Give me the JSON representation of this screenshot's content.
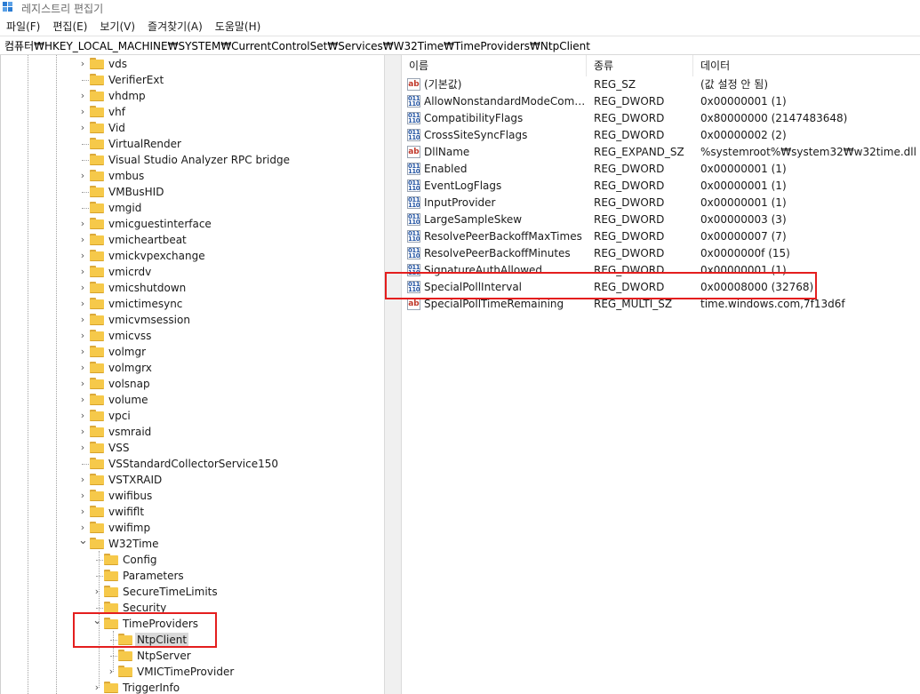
{
  "window": {
    "title": "레지스트리 편집기",
    "icon": "registry-editor-icon"
  },
  "menu": [
    "파일(F)",
    "편집(E)",
    "보기(V)",
    "즐겨찾기(A)",
    "도움말(H)"
  ],
  "address": "컴퓨터₩HKEY_LOCAL_MACHINE₩SYSTEM₩CurrentControlSet₩Services₩W32Time₩TimeProviders₩NtpClient",
  "tree": [
    {
      "label": "vds",
      "level": 0,
      "expander": "collapsed"
    },
    {
      "label": "VerifierExt",
      "level": 0,
      "expander": "none"
    },
    {
      "label": "vhdmp",
      "level": 0,
      "expander": "collapsed"
    },
    {
      "label": "vhf",
      "level": 0,
      "expander": "collapsed"
    },
    {
      "label": "Vid",
      "level": 0,
      "expander": "collapsed"
    },
    {
      "label": "VirtualRender",
      "level": 0,
      "expander": "none"
    },
    {
      "label": "Visual Studio Analyzer RPC bridge",
      "level": 0,
      "expander": "none"
    },
    {
      "label": "vmbus",
      "level": 0,
      "expander": "collapsed"
    },
    {
      "label": "VMBusHID",
      "level": 0,
      "expander": "none"
    },
    {
      "label": "vmgid",
      "level": 0,
      "expander": "none"
    },
    {
      "label": "vmicguestinterface",
      "level": 0,
      "expander": "collapsed"
    },
    {
      "label": "vmicheartbeat",
      "level": 0,
      "expander": "collapsed"
    },
    {
      "label": "vmickvpexchange",
      "level": 0,
      "expander": "collapsed"
    },
    {
      "label": "vmicrdv",
      "level": 0,
      "expander": "collapsed"
    },
    {
      "label": "vmicshutdown",
      "level": 0,
      "expander": "collapsed"
    },
    {
      "label": "vmictimesync",
      "level": 0,
      "expander": "collapsed"
    },
    {
      "label": "vmicvmsession",
      "level": 0,
      "expander": "collapsed"
    },
    {
      "label": "vmicvss",
      "level": 0,
      "expander": "collapsed"
    },
    {
      "label": "volmgr",
      "level": 0,
      "expander": "collapsed"
    },
    {
      "label": "volmgrx",
      "level": 0,
      "expander": "collapsed"
    },
    {
      "label": "volsnap",
      "level": 0,
      "expander": "collapsed"
    },
    {
      "label": "volume",
      "level": 0,
      "expander": "collapsed"
    },
    {
      "label": "vpci",
      "level": 0,
      "expander": "collapsed"
    },
    {
      "label": "vsmraid",
      "level": 0,
      "expander": "collapsed"
    },
    {
      "label": "VSS",
      "level": 0,
      "expander": "collapsed"
    },
    {
      "label": "VSStandardCollectorService150",
      "level": 0,
      "expander": "none"
    },
    {
      "label": "VSTXRAID",
      "level": 0,
      "expander": "collapsed"
    },
    {
      "label": "vwifibus",
      "level": 0,
      "expander": "collapsed"
    },
    {
      "label": "vwififlt",
      "level": 0,
      "expander": "collapsed"
    },
    {
      "label": "vwifimp",
      "level": 0,
      "expander": "collapsed"
    },
    {
      "label": "W32Time",
      "level": 0,
      "expander": "expanded"
    },
    {
      "label": "Config",
      "level": 1,
      "expander": "none"
    },
    {
      "label": "Parameters",
      "level": 1,
      "expander": "none"
    },
    {
      "label": "SecureTimeLimits",
      "level": 1,
      "expander": "collapsed"
    },
    {
      "label": "Security",
      "level": 1,
      "expander": "none"
    },
    {
      "label": "TimeProviders",
      "level": 1,
      "expander": "expanded"
    },
    {
      "label": "NtpClient",
      "level": 2,
      "expander": "none",
      "selected": true
    },
    {
      "label": "NtpServer",
      "level": 2,
      "expander": "none"
    },
    {
      "label": "VMICTimeProvider",
      "level": 2,
      "expander": "collapsed"
    },
    {
      "label": "TriggerInfo",
      "level": 1,
      "expander": "collapsed"
    }
  ],
  "columns": {
    "name": "이름",
    "type": "종류",
    "data": "데이터"
  },
  "values": [
    {
      "name": "(기본값)",
      "type": "REG_SZ",
      "data": "(값 설정 안 됨)",
      "icon": "string-value-icon"
    },
    {
      "name": "AllowNonstandardModeCombin...",
      "type": "REG_DWORD",
      "data": "0x00000001 (1)",
      "icon": "binary-value-icon"
    },
    {
      "name": "CompatibilityFlags",
      "type": "REG_DWORD",
      "data": "0x80000000 (2147483648)",
      "icon": "binary-value-icon"
    },
    {
      "name": "CrossSiteSyncFlags",
      "type": "REG_DWORD",
      "data": "0x00000002 (2)",
      "icon": "binary-value-icon"
    },
    {
      "name": "DllName",
      "type": "REG_EXPAND_SZ",
      "data": "%systemroot%₩system32₩w32time.dll",
      "icon": "string-value-icon"
    },
    {
      "name": "Enabled",
      "type": "REG_DWORD",
      "data": "0x00000001 (1)",
      "icon": "binary-value-icon"
    },
    {
      "name": "EventLogFlags",
      "type": "REG_DWORD",
      "data": "0x00000001 (1)",
      "icon": "binary-value-icon"
    },
    {
      "name": "InputProvider",
      "type": "REG_DWORD",
      "data": "0x00000001 (1)",
      "icon": "binary-value-icon"
    },
    {
      "name": "LargeSampleSkew",
      "type": "REG_DWORD",
      "data": "0x00000003 (3)",
      "icon": "binary-value-icon"
    },
    {
      "name": "ResolvePeerBackoffMaxTimes",
      "type": "REG_DWORD",
      "data": "0x00000007 (7)",
      "icon": "binary-value-icon"
    },
    {
      "name": "ResolvePeerBackoffMinutes",
      "type": "REG_DWORD",
      "data": "0x0000000f (15)",
      "icon": "binary-value-icon"
    },
    {
      "name": "SignatureAuthAllowed",
      "type": "REG_DWORD",
      "data": "0x00000001 (1)",
      "icon": "binary-value-icon"
    },
    {
      "name": "SpecialPollInterval",
      "type": "REG_DWORD",
      "data": "0x00008000 (32768)",
      "icon": "binary-value-icon",
      "highlighted": true
    },
    {
      "name": "SpecialPollTimeRemaining",
      "type": "REG_MULTI_SZ",
      "data": "time.windows.com,7f13d6f",
      "icon": "string-value-icon"
    }
  ],
  "annotation_color": "#e41e1e"
}
